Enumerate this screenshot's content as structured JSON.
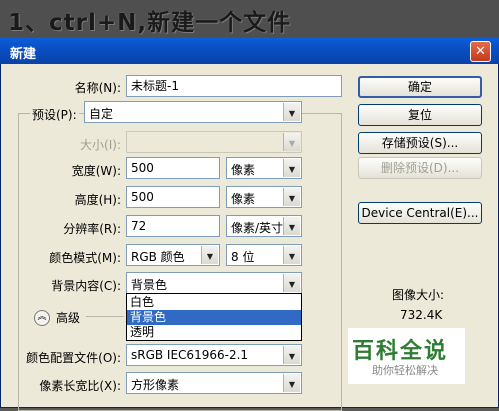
{
  "banner": {
    "text": "1、ctrl+N,新建一个文件"
  },
  "window": {
    "title": "新建"
  },
  "form": {
    "name_label": "名称(N):",
    "name_value": "未标题-1",
    "preset_label": "预设(P):",
    "preset_value": "自定",
    "size_label": "大小(I):",
    "size_value": "",
    "width_label": "宽度(W):",
    "width_value": "500",
    "width_unit": "像素",
    "height_label": "高度(H):",
    "height_value": "500",
    "height_unit": "像素",
    "resolution_label": "分辨率(R):",
    "resolution_value": "72",
    "resolution_unit": "像素/英寸",
    "color_mode_label": "颜色模式(M):",
    "color_mode_value": "RGB 颜色",
    "bit_depth_value": "8 位",
    "background_label": "背景内容(C):",
    "background_value": "背景色",
    "advanced_label": "高级",
    "color_profile_label": "颜色配置文件(O):",
    "color_profile_value": "sRGB IEC61966-2.1",
    "pixel_aspect_label": "像素长宽比(X):",
    "pixel_aspect_value": "方形像素"
  },
  "background_dropdown": {
    "options": [
      "白色",
      "背景色",
      "透明"
    ],
    "highlighted": "背景色"
  },
  "buttons": {
    "ok": "确定",
    "reset": "复位",
    "save_preset": "存储预设(S)...",
    "delete_preset": "删除预设(D)...",
    "device_central": "Device Central(E)..."
  },
  "image_size": {
    "label": "图像大小:",
    "value": "732.4K"
  },
  "watermark": {
    "title": "百科全说",
    "subtitle": "助你轻松解决"
  },
  "icons": {
    "close": "close-icon",
    "dropdown": "chevron-down-icon",
    "advanced_toggle": "double-chevron-up-icon"
  },
  "colors": {
    "titlebar": "#0b4fc4",
    "dialog_bg": "#ece9d8",
    "highlight": "#316ac5",
    "watermark_green": "#2e7d32"
  }
}
